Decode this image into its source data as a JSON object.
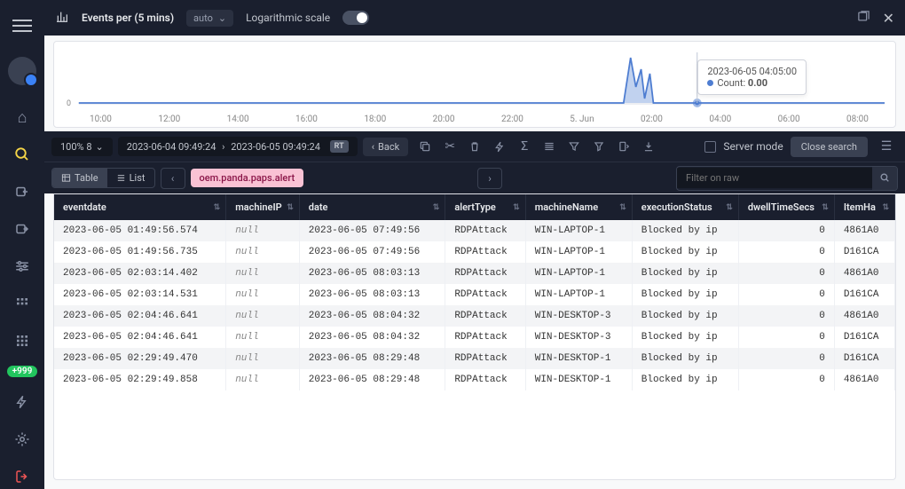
{
  "topbar": {
    "title": "Events per (5 mins)",
    "interval": "auto",
    "log_label": "Logarithmic scale"
  },
  "chart_data": {
    "type": "line",
    "x_ticks": [
      "10:00",
      "12:00",
      "14:00",
      "16:00",
      "18:00",
      "20:00",
      "22:00",
      "5. Jun",
      "02:00",
      "04:00",
      "06:00",
      "08:00"
    ],
    "series": [
      {
        "name": "Count",
        "values_sparse": {
          "03:00": 8,
          "03:05": 14,
          "03:10": 6,
          "03:15": 9,
          "04:05": 0
        }
      }
    ],
    "ylabel_zero": "0",
    "tooltip": {
      "time": "2023-06-05 04:05:00",
      "label": "Count",
      "value": "0.00"
    }
  },
  "toolbar": {
    "zoom": "100% 8",
    "range_from": "2023-06-04 09:49:24",
    "range_to": "2023-06-05 09:49:24",
    "rt": "RT",
    "back": "Back",
    "server_mode": "Server mode",
    "close_search": "Close search"
  },
  "subtoolbar": {
    "table": "Table",
    "list": "List",
    "query": "oem.panda.paps.alert",
    "filter_placeholder": "Filter on raw"
  },
  "table": {
    "columns": [
      "eventdate",
      "machineIP",
      "date",
      "alertType",
      "machineName",
      "executionStatus",
      "dwellTimeSecs",
      "ItemHa"
    ],
    "rows": [
      {
        "eventdate": "2023-06-05 01:49:56.574",
        "machineIP": "null",
        "date": "2023-06-05 07:49:56",
        "alertType": "RDPAttack",
        "machineName": "WIN-LAPTOP-1",
        "executionStatus": "Blocked by ip",
        "dwellTimeSecs": "0",
        "ItemHa": "4861A0"
      },
      {
        "eventdate": "2023-06-05 01:49:56.735",
        "machineIP": "null",
        "date": "2023-06-05 07:49:56",
        "alertType": "RDPAttack",
        "machineName": "WIN-LAPTOP-1",
        "executionStatus": "Blocked by ip",
        "dwellTimeSecs": "0",
        "ItemHa": "D161CA"
      },
      {
        "eventdate": "2023-06-05 02:03:14.402",
        "machineIP": "null",
        "date": "2023-06-05 08:03:13",
        "alertType": "RDPAttack",
        "machineName": "WIN-LAPTOP-1",
        "executionStatus": "Blocked by ip",
        "dwellTimeSecs": "0",
        "ItemHa": "4861A0"
      },
      {
        "eventdate": "2023-06-05 02:03:14.531",
        "machineIP": "null",
        "date": "2023-06-05 08:03:13",
        "alertType": "RDPAttack",
        "machineName": "WIN-LAPTOP-1",
        "executionStatus": "Blocked by ip",
        "dwellTimeSecs": "0",
        "ItemHa": "D161CA"
      },
      {
        "eventdate": "2023-06-05 02:04:46.641",
        "machineIP": "null",
        "date": "2023-06-05 08:04:32",
        "alertType": "RDPAttack",
        "machineName": "WIN-DESKTOP-3",
        "executionStatus": "Blocked by ip",
        "dwellTimeSecs": "0",
        "ItemHa": "4861A0"
      },
      {
        "eventdate": "2023-06-05 02:04:46.641",
        "machineIP": "null",
        "date": "2023-06-05 08:04:32",
        "alertType": "RDPAttack",
        "machineName": "WIN-DESKTOP-3",
        "executionStatus": "Blocked by ip",
        "dwellTimeSecs": "0",
        "ItemHa": "D161CA"
      },
      {
        "eventdate": "2023-06-05 02:29:49.470",
        "machineIP": "null",
        "date": "2023-06-05 08:29:48",
        "alertType": "RDPAttack",
        "machineName": "WIN-DESKTOP-1",
        "executionStatus": "Blocked by ip",
        "dwellTimeSecs": "0",
        "ItemHa": "D161CA"
      },
      {
        "eventdate": "2023-06-05 02:29:49.858",
        "machineIP": "null",
        "date": "2023-06-05 08:29:48",
        "alertType": "RDPAttack",
        "machineName": "WIN-DESKTOP-1",
        "executionStatus": "Blocked by ip",
        "dwellTimeSecs": "0",
        "ItemHa": "4861A0"
      }
    ]
  },
  "sidebar_badge": "+999"
}
